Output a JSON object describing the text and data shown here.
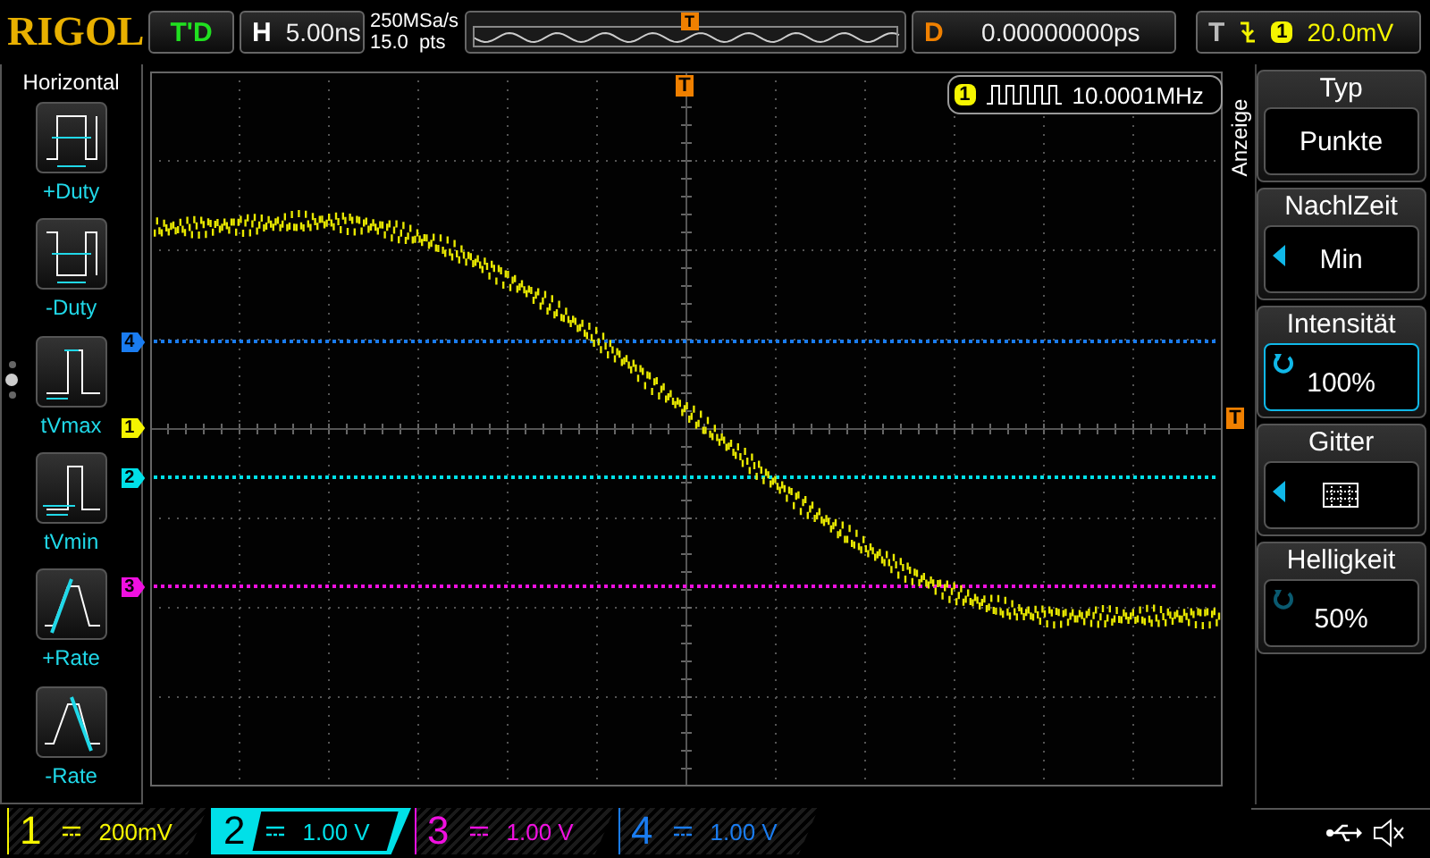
{
  "header": {
    "logo": "RIGOL",
    "run_status": "T'D",
    "horizontal": {
      "label": "H",
      "value": "5.00ns"
    },
    "sample_rate": "250MSa/s",
    "memory_depth": "15.0  pts",
    "trigger_position": "T",
    "delay": {
      "label": "D",
      "value": "0.00000000ps"
    },
    "trigger": {
      "label": "T",
      "source": "1",
      "level": "20.0mV"
    }
  },
  "left_menu": {
    "title": "Horizontal",
    "pages": [
      {
        "selected": false
      },
      {
        "selected": true
      },
      {
        "selected": false
      }
    ],
    "items": [
      {
        "label": "+Duty",
        "kind": "pos-duty"
      },
      {
        "label": "-Duty",
        "kind": "neg-duty"
      },
      {
        "label": "tVmax",
        "kind": "tvmax"
      },
      {
        "label": "tVmin",
        "kind": "tvmin"
      },
      {
        "label": "+Rate",
        "kind": "pos-rate"
      },
      {
        "label": "-Rate",
        "kind": "neg-rate"
      }
    ]
  },
  "screen": {
    "top_trigger_marker": "T",
    "trigger_level_marker": "T",
    "frequency_counter": {
      "channel": "1",
      "value": "10.0001MHz"
    },
    "channel_markers": [
      {
        "label": "4",
        "color": "#1a7cf0"
      },
      {
        "label": "1",
        "color": "#f5f500"
      },
      {
        "label": "2",
        "color": "#00e0e8"
      },
      {
        "label": "3",
        "color": "#f010e0"
      }
    ]
  },
  "right_menu": {
    "title": "Anzeige",
    "items": [
      {
        "label": "Typ",
        "value": "Punkte",
        "kind": "plain",
        "selected": false
      },
      {
        "label": "NachlZeit",
        "value": "Min",
        "kind": "arrow",
        "selected": false
      },
      {
        "label": "Intensität",
        "value": "100%",
        "kind": "knob",
        "selected": true
      },
      {
        "label": "Gitter",
        "kind": "grid",
        "selected": false
      },
      {
        "label": "Helligkeit",
        "value": "50%",
        "kind": "knob",
        "selected": false
      }
    ]
  },
  "channels": [
    {
      "number": "1",
      "scale": "200mV",
      "color": "#f5f500",
      "selected": false
    },
    {
      "number": "2",
      "scale": "1.00 V",
      "color": "#00e0e8",
      "selected": true
    },
    {
      "number": "3",
      "scale": "1.00 V",
      "color": "#f010e0",
      "selected": false
    },
    {
      "number": "4",
      "scale": "1.00 V",
      "color": "#1a7cf0",
      "selected": false
    }
  ]
}
